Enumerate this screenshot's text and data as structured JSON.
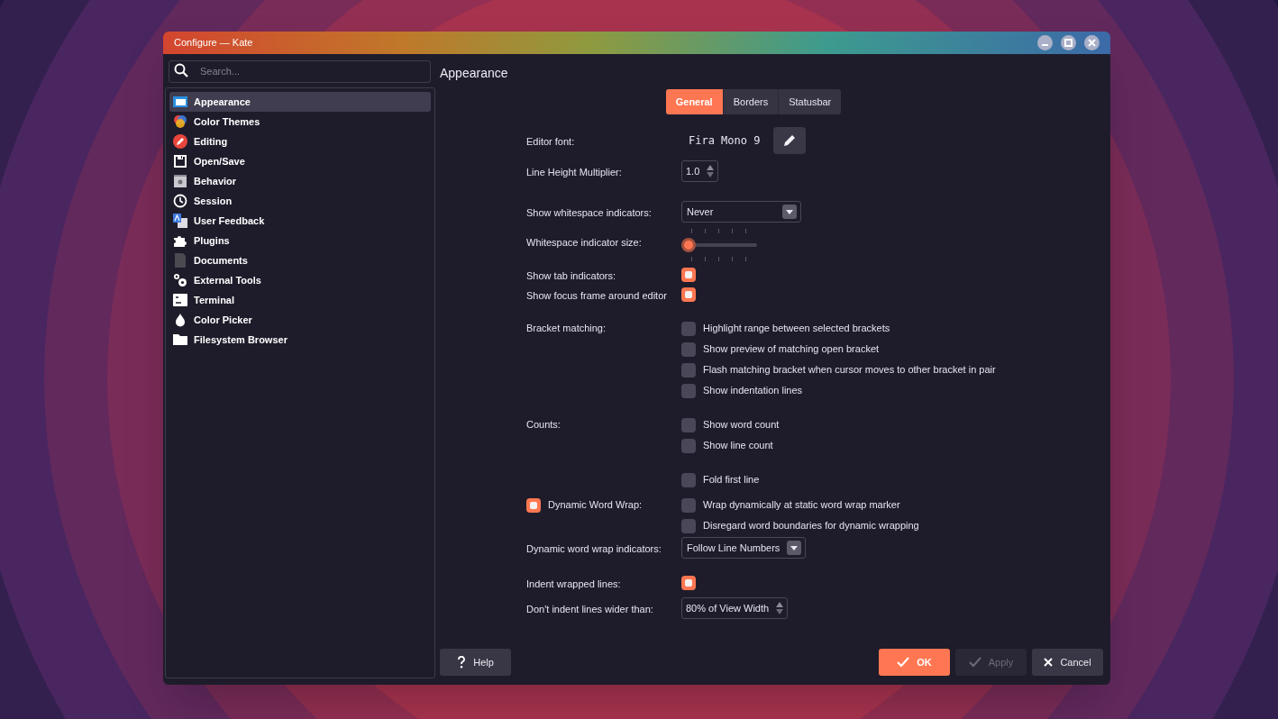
{
  "window": {
    "title": "Configure — Kate"
  },
  "search": {
    "placeholder": "Search..."
  },
  "sidebar": {
    "items": [
      {
        "label": "Appearance",
        "selected": true
      },
      {
        "label": "Color Themes",
        "selected": false
      },
      {
        "label": "Editing",
        "selected": false
      },
      {
        "label": "Open/Save",
        "selected": false
      },
      {
        "label": "Behavior",
        "selected": false
      },
      {
        "label": "Session",
        "selected": false
      },
      {
        "label": "User Feedback",
        "selected": false
      },
      {
        "label": "Plugins",
        "selected": false
      },
      {
        "label": "Documents",
        "selected": false
      },
      {
        "label": "External Tools",
        "selected": false
      },
      {
        "label": "Terminal",
        "selected": false
      },
      {
        "label": "Color Picker",
        "selected": false
      },
      {
        "label": "Filesystem Browser",
        "selected": false
      }
    ]
  },
  "page": {
    "title": "Appearance"
  },
  "tabs": [
    {
      "label": "General",
      "selected": true
    },
    {
      "label": "Borders",
      "selected": false
    },
    {
      "label": "Statusbar",
      "selected": false
    }
  ],
  "sections": [
    {
      "rows": [
        {
          "kind": "font",
          "label": "Editor font:",
          "value": "Fira Mono 9"
        },
        {
          "kind": "spin",
          "label": "Line Height Multiplier:",
          "value": "1.0"
        }
      ]
    },
    {
      "rows": [
        {
          "kind": "combo",
          "label": "Show whitespace indicators:",
          "value": "Never"
        },
        {
          "kind": "slider",
          "label": "Whitespace indicator size:",
          "level": 0
        },
        {
          "kind": "check",
          "label": "Show tab indicators:",
          "checked": true
        },
        {
          "kind": "check",
          "label": "Show focus frame around editor",
          "checked": true
        }
      ]
    },
    {
      "rows": [
        {
          "kind": "options",
          "label": "Bracket matching:",
          "options": [
            {
              "text": "Highlight range between selected brackets",
              "checked": false
            },
            {
              "text": "Show preview of matching open bracket",
              "checked": false
            },
            {
              "text": "Flash matching bracket when cursor moves to other bracket in pair",
              "checked": false
            },
            {
              "text": "Show indentation lines",
              "checked": false
            }
          ]
        }
      ]
    },
    {
      "rows": [
        {
          "kind": "options",
          "label": "Counts:",
          "options": [
            {
              "text": "Show word count",
              "checked": false
            },
            {
              "text": "Show line count",
              "checked": false
            }
          ]
        }
      ]
    },
    {
      "rows": [
        {
          "kind": "options",
          "options": [
            {
              "text": "Fold first line",
              "checked": false
            }
          ]
        },
        {
          "kind": "toggle",
          "label": "Dynamic Word Wrap:",
          "checked": true,
          "options": [
            {
              "text": "Wrap dynamically at static word wrap marker",
              "checked": false
            },
            {
              "text": "Disregard word boundaries for dynamic wrapping",
              "checked": false
            }
          ]
        },
        {
          "kind": "combo",
          "label": "Dynamic word wrap indicators:",
          "value": "Follow Line Numbers"
        }
      ]
    },
    {
      "rows": [
        {
          "kind": "check",
          "label": "Indent wrapped lines:",
          "checked": true
        },
        {
          "kind": "spin",
          "label": "Don't indent lines wider than:",
          "value": "80% of View Width"
        }
      ]
    }
  ],
  "buttons": [
    {
      "kind": "help",
      "label": "Help",
      "disabled": false
    },
    {
      "kind": "ok",
      "label": "OK",
      "disabled": false
    },
    {
      "kind": "apply",
      "label": "Apply",
      "disabled": true
    },
    {
      "kind": "cancel",
      "label": "Cancel",
      "disabled": false
    }
  ]
}
